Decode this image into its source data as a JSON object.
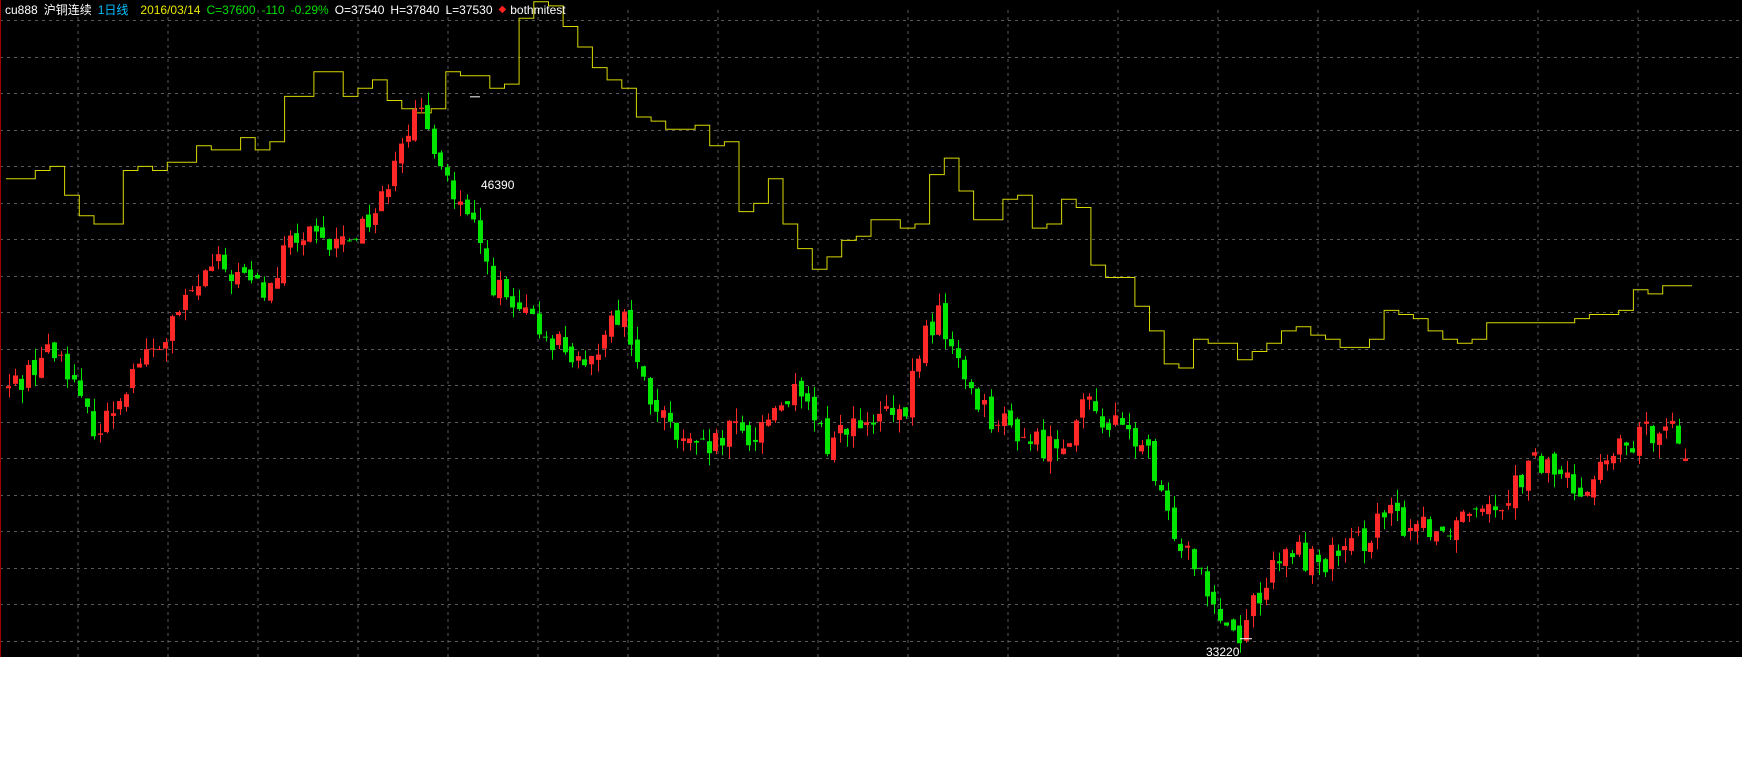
{
  "header": {
    "symbol": "cu888",
    "name": "沪铜连续",
    "period": "1日线",
    "date": "2016/03/14",
    "close": "C=37600",
    "change": "-110",
    "change_pct": "-0.29%",
    "open": "O=37540",
    "high": "H=37840",
    "low": "L=37530",
    "indicator_marker": "◆",
    "indicator_name": "bothmitest"
  },
  "colors": {
    "background": "#000000",
    "grid": "#5a5a5a",
    "up_candle": "#ff2828",
    "down_candle": "#00e600",
    "indicator_line": "#d8d800",
    "header_symbol": "#ffffff",
    "header_period": "#00c0ff",
    "header_date": "#e8e800",
    "header_change": "#00e000",
    "header_ohlc": "#ffffff",
    "indicator_marker": "#ff2020",
    "label_text": "#ffffff"
  },
  "annotations": {
    "max_label": "46390",
    "min_label": "33220"
  },
  "chart_data": {
    "type": "candlestick",
    "title": "cu888 沪铜连续 1日线",
    "y_range_est": [
      32800,
      48500
    ],
    "max_price": 46390,
    "min_price": 33220,
    "last": {
      "date": "2016/03/14",
      "open": 37540,
      "high": 37840,
      "low": 37530,
      "close": 37600,
      "change": -110,
      "change_pct": -0.29
    },
    "price_path": [
      39300,
      39700,
      40200,
      40100,
      38700,
      38300,
      39200,
      40000,
      40200,
      41000,
      41700,
      42300,
      42100,
      41900,
      41600,
      42800,
      43000,
      42700,
      42900,
      43300,
      43800,
      45500,
      45900,
      45200,
      43800,
      43100,
      41900,
      41200,
      40900,
      40600,
      40300,
      39500,
      40900,
      41200,
      39400,
      38600,
      38000,
      37700,
      37900,
      38300,
      38100,
      38800,
      39200,
      38700,
      37900,
      38500,
      38200,
      38700,
      38400,
      40500,
      41100,
      39800,
      39100,
      38500,
      38300,
      38000,
      37900,
      38300,
      38900,
      38500,
      38200,
      37900,
      36300,
      35600,
      35000,
      33800,
      33300,
      34300,
      34900,
      35400,
      35100,
      35200,
      35300,
      35800,
      36200,
      36000,
      36100,
      35800,
      36300,
      36700,
      36500,
      37100,
      37500,
      37300,
      36900,
      37100,
      37600,
      37900,
      38200,
      38700,
      37600
    ],
    "indicator_line": {
      "name": "bothmitest",
      "values": [
        44400,
        44400,
        44600,
        44700,
        44000,
        43500,
        43300,
        43300,
        44600,
        44700,
        44600,
        44800,
        44800,
        45200,
        45100,
        45100,
        45400,
        45100,
        45300,
        46400,
        46400,
        47000,
        47000,
        46400,
        46600,
        46800,
        46300,
        46100,
        46000,
        46100,
        47000,
        46900,
        46900,
        46600,
        46700,
        48300,
        48700,
        48600,
        48100,
        47600,
        47100,
        46800,
        46600,
        45900,
        45800,
        45600,
        45600,
        45700,
        45200,
        45300,
        43600,
        43800,
        44400,
        43300,
        42700,
        42200,
        42500,
        42900,
        43000,
        43400,
        43400,
        43200,
        43300,
        44500,
        44900,
        44100,
        43400,
        43400,
        43900,
        44000,
        43200,
        43300,
        43900,
        43700,
        42300,
        42000,
        42000,
        41300,
        40700,
        39900,
        39800,
        40500,
        40400,
        40400,
        40000,
        40200,
        40400,
        40700,
        40800,
        40600,
        40500,
        40300,
        40300,
        40500,
        41200,
        41100,
        41000,
        40700,
        40500,
        40400,
        40500,
        40900,
        40900,
        40900,
        40900,
        40900,
        40900,
        41000,
        41100,
        41100,
        41200,
        41700,
        41600,
        41800,
        41800,
        41800
      ]
    }
  }
}
